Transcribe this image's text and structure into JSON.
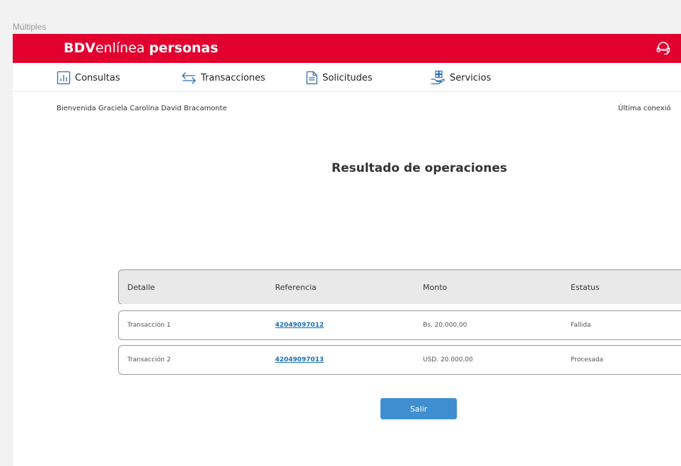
{
  "frame_label": "Múltiples",
  "brand": {
    "part1": "BDV",
    "part2": "enlínea",
    "part3": "personas"
  },
  "colors": {
    "brand_red": "#e2002e",
    "button_blue": "#3f8fd0",
    "link_blue": "#1a6fb4"
  },
  "nav": {
    "items": [
      {
        "label": "Consultas",
        "icon": "bar-chart-icon"
      },
      {
        "label": "Transacciones",
        "icon": "transfer-arrows-icon"
      },
      {
        "label": "Solicitudes",
        "icon": "document-icon"
      },
      {
        "label": "Servicios",
        "icon": "hand-boxes-icon"
      }
    ]
  },
  "header": {
    "welcome": "Bienvenida Graciela Carolina David Bracamonte",
    "last_connection": "Última conexió"
  },
  "main": {
    "title": "Resultado de operaciones",
    "table": {
      "columns": [
        "Detalle",
        "Referencia",
        "Monto",
        "Estatus"
      ],
      "rows": [
        {
          "detalle": "Transacción 1",
          "referencia": "42049097012",
          "monto": "Bs. 20.000,00",
          "estatus": "Fallida"
        },
        {
          "detalle": "Transacción 2",
          "referencia": "42049097013",
          "monto": "USD. 20.000,00",
          "estatus": "Procesada"
        }
      ]
    },
    "exit_button": "Salir"
  }
}
